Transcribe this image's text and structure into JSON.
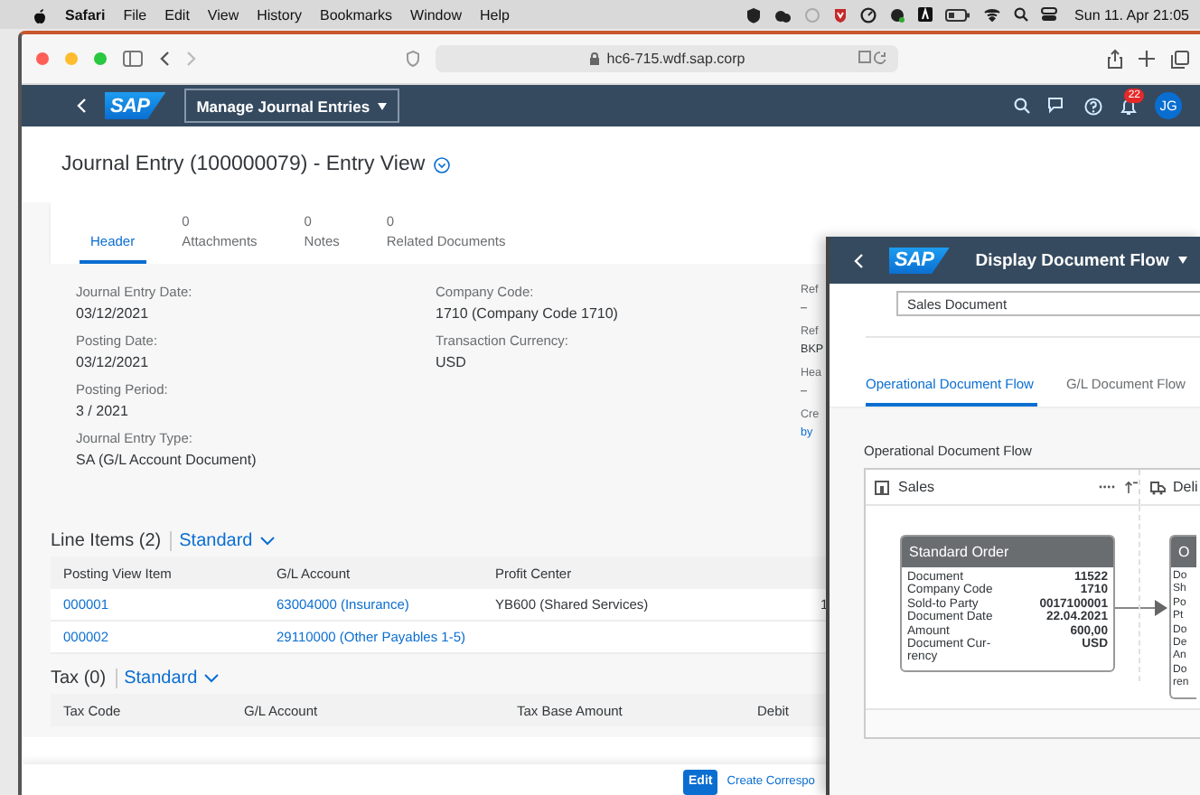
{
  "menu_bar": {
    "app": "Safari",
    "items": [
      "File",
      "Edit",
      "View",
      "History",
      "Bookmarks",
      "Window",
      "Help"
    ],
    "clock": "Sun 11. Apr 21:05"
  },
  "browser": {
    "url": "hc6-715.wdf.sap.corp"
  },
  "shell_bar": {
    "logo": "SAP",
    "app_title": "Manage Journal Entries",
    "notification_count": "22",
    "user_initials": "JG"
  },
  "page": {
    "title": "Journal Entry (100000079) - Entry View",
    "tabs": [
      {
        "label": "Header",
        "selected": true
      },
      {
        "count": "0",
        "label": "Attachments",
        "selected": false
      },
      {
        "count": "0",
        "label": "Notes",
        "selected": false
      },
      {
        "count": "0",
        "label": "Related Documents",
        "selected": false
      }
    ],
    "header_fields": [
      [
        {
          "label": "Journal Entry Date:",
          "value": "03/12/2021",
          "link": false
        },
        {
          "label": "Posting Date:",
          "value": "03/12/2021",
          "link": false
        },
        {
          "label": "Posting Period:",
          "value": "3 / 2021",
          "link": false
        },
        {
          "label": "Journal Entry Type:",
          "value": "SA (G/L Account Document)",
          "link": false
        }
      ],
      [
        {
          "label": "Company Code:",
          "value": "1710 (Company Code 1710)",
          "link": false
        },
        {
          "label": "Transaction Currency:",
          "value": "USD",
          "link": false
        }
      ],
      [
        {
          "label": "Ref",
          "value": "–",
          "link": false
        },
        {
          "label": "Ref",
          "value": "BKP",
          "link": false
        },
        {
          "label": "Hea",
          "value": "–",
          "link": false
        },
        {
          "label": "Cre",
          "value": "by",
          "link": true
        }
      ]
    ],
    "line_items": {
      "title": "Line Items (2)",
      "variant": "Standard",
      "columns": [
        "Posting View Item",
        "G/L Account",
        "Profit Center"
      ],
      "rows": [
        {
          "cells": [
            {
              "text": "000001",
              "link": true
            },
            {
              "text": "63004000 (Insurance)",
              "link": true
            },
            {
              "text": "YB600 (Shared Services)",
              "link": false
            },
            {
              "text": "1",
              "link": false
            }
          ]
        },
        {
          "cells": [
            {
              "text": "000002",
              "link": true
            },
            {
              "text": "29110000 (Other Payables 1-5)",
              "link": true
            }
          ]
        }
      ]
    },
    "tax": {
      "title": "Tax (0)",
      "variant": "Standard",
      "columns": [
        "Tax Code",
        "G/L Account",
        "Tax Base Amount",
        "Debit"
      ]
    },
    "footer_buttons": [
      {
        "label": "Edit",
        "kind": "primary"
      },
      {
        "label": "Create Correspo",
        "kind": "link"
      }
    ]
  },
  "flow_window": {
    "logo": "SAP",
    "title": "Display Document Flow",
    "field_value": "Sales Document",
    "tabs": [
      {
        "label": "Operational Document Flow",
        "selected": true
      },
      {
        "label": "G/L Document Flow",
        "selected": false
      }
    ],
    "section_title": "Operational Document Flow",
    "lanes": [
      "Sales",
      "Deli"
    ],
    "card": {
      "title": "Standard Order",
      "fields": [
        {
          "label": "Document",
          "value": "11522"
        },
        {
          "label": "Company Code",
          "value": "1710"
        },
        {
          "label": "Sold-to Party",
          "value": "0017100001"
        },
        {
          "label": "Document Date",
          "value": "22.04.2021"
        },
        {
          "label": "Amount",
          "value": "600,00"
        },
        {
          "label": "Document Cur-rency",
          "value": "USD"
        }
      ]
    },
    "next_card": {
      "title": "O",
      "lines": [
        "Do",
        "Sh",
        "Po",
        "Pt",
        "Do",
        "De",
        "An",
        "Do",
        "ren"
      ]
    }
  }
}
